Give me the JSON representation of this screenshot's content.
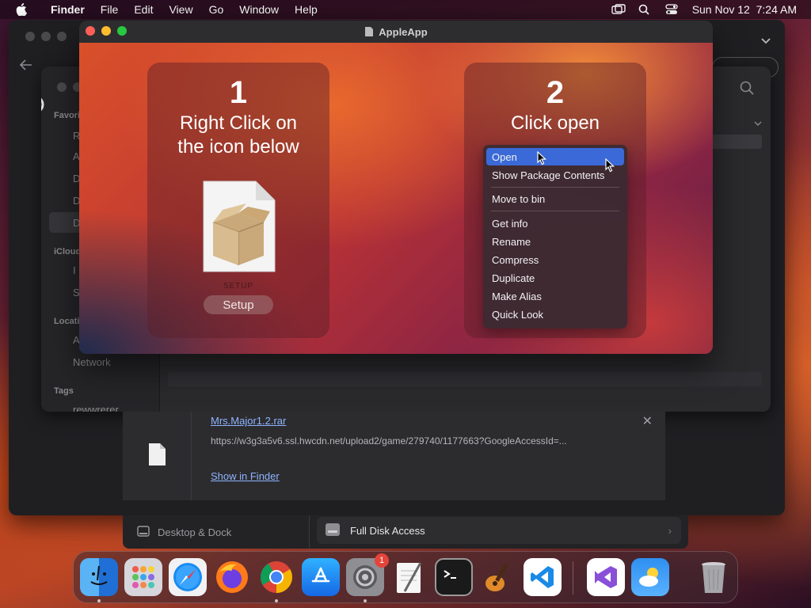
{
  "menubar": {
    "app_name": "Finder",
    "items": [
      "File",
      "Edit",
      "View",
      "Go",
      "Window",
      "Help"
    ],
    "clock": "Sun Nov 12  7:24 AM"
  },
  "finder": {
    "sidebar": {
      "favorites_label": "Favori",
      "icloud_label": "iCloud",
      "locations_label": "Locati",
      "network_label": "Network",
      "tags_label": "Tags",
      "tag_item": "rewwrerer"
    }
  },
  "app_window": {
    "title": "AppleApp",
    "step1": {
      "number": "1",
      "text_line1": "Right Click on",
      "text_line2": "the icon below"
    },
    "package_caption": "SETUP",
    "setup_label": "Setup",
    "step2": {
      "number": "2",
      "text": "Click open"
    },
    "context_menu": [
      "Open",
      "Show Package Contents",
      "Move to bin",
      "Get info",
      "Rename",
      "Compress",
      "Duplicate",
      "Make Alias",
      "Quick Look"
    ]
  },
  "download": {
    "filename": "Mrs.Major1.2.rar",
    "url": "https://w3g3a5v6.ssl.hwcdn.net/upload2/game/279740/1177663?GoogleAccessId=...",
    "show_in_finder": "Show in Finder"
  },
  "settings": {
    "left_item": "Desktop & Dock",
    "right_item": "Full Disk Access"
  },
  "dock": {
    "apps": [
      "Finder",
      "Launchpad",
      "Safari",
      "Firefox",
      "Chrome",
      "App Store",
      "System Settings",
      "TextEdit",
      "Terminal",
      "GarageBand",
      "VS Code",
      "Visual Studio",
      "Weather",
      "Trash"
    ],
    "settings_badge": "1"
  },
  "colors": {
    "menu_highlight": "#3b6ad8",
    "link": "#8fb4ff",
    "badge": "#e5443a"
  }
}
